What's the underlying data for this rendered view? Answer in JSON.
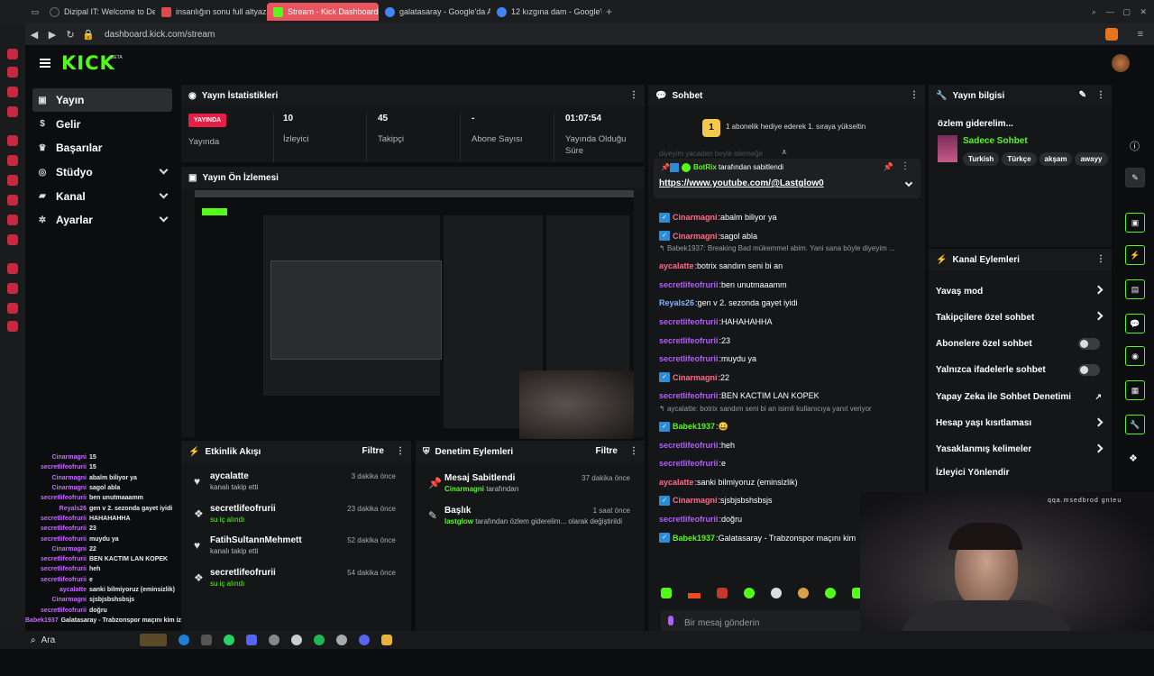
{
  "browser": {
    "tabs": [
      {
        "label": "Dizipal IT: Welcome to De",
        "color": "#222"
      },
      {
        "label": "insanlığın sonu full altyaz",
        "color": "#e0484d"
      },
      {
        "label": "Stream - Kick Dashboard",
        "color": "#53fc18"
      },
      {
        "label": "galatasaray - Google'da A",
        "color": "#4285f4"
      },
      {
        "label": "12 kızgına dam - Google'd",
        "color": "#4285f4"
      }
    ],
    "url": "dashboard.kick.com/stream"
  },
  "brand": {
    "logo": "KICK",
    "beta": "BETA"
  },
  "nav": [
    {
      "label": "Yayın",
      "icon": "stream-icon",
      "glyph": "▣",
      "active": true
    },
    {
      "label": "Gelir",
      "icon": "dollar-icon",
      "glyph": "$"
    },
    {
      "label": "Başarılar",
      "icon": "trophy-icon",
      "glyph": "♛"
    },
    {
      "label": "Stüdyo",
      "icon": "studio-icon",
      "glyph": "◎"
    },
    {
      "label": "Kanal",
      "icon": "channel-icon",
      "glyph": "▰"
    },
    {
      "label": "Ayarlar",
      "icon": "gear-icon",
      "glyph": "✲"
    }
  ],
  "overlay_chat": [
    {
      "u": "Cinarmagni",
      "m": "15"
    },
    {
      "u": "secretlifeofrurii",
      "m": "15"
    },
    {
      "u": "Cinarmagni",
      "m": "abalm biliyor ya"
    },
    {
      "u": "Cinarmagni",
      "m": "sagol abla"
    },
    {
      "u": "secretlifeofrurii",
      "m": "ben unutmaaamm"
    },
    {
      "u": "Reyals26",
      "m": "gen v 2. sezonda gayet iyidi"
    },
    {
      "u": "secretlifeofrurii",
      "m": "HAHAHAHHA"
    },
    {
      "u": "secretlifeofrurii",
      "m": "23"
    },
    {
      "u": "secretlifeofrurii",
      "m": "muydu ya"
    },
    {
      "u": "Cinarmagni",
      "m": "22"
    },
    {
      "u": "secretlifeofrurii",
      "m": "BEN KACTIM LAN KOPEK"
    },
    {
      "u": "secretlifeofrurii",
      "m": "heh"
    },
    {
      "u": "secretlifeofrurii",
      "m": "e"
    },
    {
      "u": "aycalatte",
      "m": "sanki bilmiyoruz (eminsizlik)"
    },
    {
      "u": "Cinarmagni",
      "m": "sjsbjsbshsbsjs"
    },
    {
      "u": "secretlifeofrurii",
      "m": "doğru"
    },
    {
      "u": "Babek1937",
      "m": "Galatasaray - Trabzonspor maçını kim izliyor ?"
    }
  ],
  "stats": {
    "title": "Yayın İstatistikleri",
    "live": "YAYINDA",
    "live_label": "Yayında",
    "viewers": "10",
    "viewers_label": "İzleyici",
    "followers": "45",
    "followers_label": "Takipçi",
    "subs": "-",
    "subs_label": "Abone Sayısı",
    "duration": "01:07:54",
    "duration_label": "Yayında Olduğu Süre"
  },
  "preview": {
    "title": "Yayın Ön İzlemesi"
  },
  "activity": {
    "title": "Etkinlik Akışı",
    "filter": "Filtre",
    "items": [
      {
        "name": "aycalatte",
        "desc": "kanalı takip etti",
        "time": "3 dakika önce",
        "icon": "heart-icon",
        "glyph": "♥"
      },
      {
        "name": "secretlifeofrurii",
        "desc": "su iç alındı",
        "time": "23 dakika önce",
        "icon": "kick-icon",
        "glyph": "❖"
      },
      {
        "name": "FatihSultannMehmett",
        "desc": "kanalı takip etti",
        "time": "52 dakika önce",
        "icon": "heart-icon",
        "glyph": "♥"
      },
      {
        "name": "secretlifeofrurii",
        "desc": "su iç alındı",
        "time": "54 dakika önce",
        "icon": "kick-icon",
        "glyph": "❖"
      }
    ]
  },
  "moderation": {
    "title": "Denetim Eylemleri",
    "filter": "Filtre",
    "items": [
      {
        "name": "Mesaj Sabitlendi",
        "user": "Cinarmagni",
        "rest": " tarafından",
        "time": "37 dakika önce"
      },
      {
        "name": "Başlık",
        "user": "lastglow",
        "rest": " tarafından özlem giderelim... olarak değiştirildi",
        "time": "1 saat önce"
      }
    ]
  },
  "chat": {
    "title": "Sohbet",
    "gift": "1 abonelik hediye ederek 1. sıraya yükseltin",
    "gift_badge": "1",
    "fade": "diyeyim yacaden beyle islemeğe",
    "pinned_by": "BotRix",
    "pinned_suffix": " tarafından sabitlendi",
    "pinned_link": "https://www.youtube.com/@Lastglow0",
    "placeholder": "Bir mesaj gönderin",
    "messages": [
      {
        "type": "msg",
        "u": "Cinarmagni",
        "m": "abalm biliyor ya",
        "c": "#ff6b8a",
        "badge": true
      },
      {
        "type": "msg",
        "u": "Cinarmagni",
        "m": "sagol abla",
        "c": "#ff6b8a",
        "badge": true
      },
      {
        "type": "reply",
        "m": "Babek1937: Breaking Bad mükemmel abim. Yani sana böyle diyeyim ..."
      },
      {
        "type": "msg",
        "u": "aycalatte",
        "m": "botrix sandım seni bi an",
        "c": "#ff6b8a"
      },
      {
        "type": "msg",
        "u": "secretlifeofrurii",
        "m": "ben unutmaaamm",
        "c": "#b35dff"
      },
      {
        "type": "msg",
        "u": "Reyals26",
        "m": "gen v 2. sezonda gayet iyidi",
        "c": "#7fb4ff"
      },
      {
        "type": "msg",
        "u": "secretlifeofrurii",
        "m": "HAHAHAHHA",
        "c": "#b35dff"
      },
      {
        "type": "msg",
        "u": "secretlifeofrurii",
        "m": "23",
        "c": "#b35dff"
      },
      {
        "type": "msg",
        "u": "secretlifeofrurii",
        "m": "muydu ya",
        "c": "#b35dff"
      },
      {
        "type": "msg",
        "u": "Cinarmagni",
        "m": "22",
        "c": "#ff6b8a",
        "badge": true
      },
      {
        "type": "msg",
        "u": "secretlifeofrurii",
        "m": "BEN KACTIM LAN KOPEK",
        "c": "#b35dff"
      },
      {
        "type": "reply",
        "m": "aycalatte: botrix sandım seni bi an isimli kullanıcıya yanıt veriyor"
      },
      {
        "type": "msg",
        "u": "Babek1937",
        "m": "😀",
        "c": "#53fc18",
        "badge": true
      },
      {
        "type": "msg",
        "u": "secretlifeofrurii",
        "m": "heh",
        "c": "#b35dff"
      },
      {
        "type": "msg",
        "u": "secretlifeofrurii",
        "m": "e",
        "c": "#b35dff"
      },
      {
        "type": "msg",
        "u": "aycalatte",
        "m": "sanki bilmiyoruz (eminsizlik)",
        "c": "#ff6b8a"
      },
      {
        "type": "msg",
        "u": "Cinarmagni",
        "m": "sjsbjsbshsbsjs",
        "c": "#ff6b8a",
        "badge": true
      },
      {
        "type": "msg",
        "u": "secretlifeofrurii",
        "m": "doğru",
        "c": "#b35dff"
      },
      {
        "type": "msg",
        "u": "Babek1937",
        "m": "Galatasaray - Trabzonspor maçını kim",
        "c": "#53fc18",
        "badge": true
      }
    ]
  },
  "stream_info": {
    "title": "Yayın bilgisi",
    "stream_title": "özlem giderelim...",
    "category": "Sadece Sohbet",
    "tags": [
      "Turkish",
      "Türkçe",
      "akşam",
      "awayy"
    ]
  },
  "channel_actions": {
    "title": "Kanal Eylemleri",
    "items": [
      {
        "label": "Yavaş mod",
        "ctl": "arrow"
      },
      {
        "label": "Takipçilere özel sohbet",
        "ctl": "arrow"
      },
      {
        "label": "Abonelere özel sohbet",
        "ctl": "toggle"
      },
      {
        "label": "Yalnızca ifadelerle sohbet",
        "ctl": "toggle"
      },
      {
        "label": "Yapay Zeka ile Sohbet Denetimi",
        "ctl": "ext"
      },
      {
        "label": "Hesap yaşı kısıtlaması",
        "ctl": "arrow"
      },
      {
        "label": "Yasaklanmış kelimeler",
        "ctl": "arrow"
      },
      {
        "label": "İzleyici Yönlendir",
        "ctl": "none"
      }
    ]
  },
  "webcam": {
    "mirror_text": "qqa.msedbrod gnteu"
  },
  "taskbar": {
    "search": "Ara"
  }
}
